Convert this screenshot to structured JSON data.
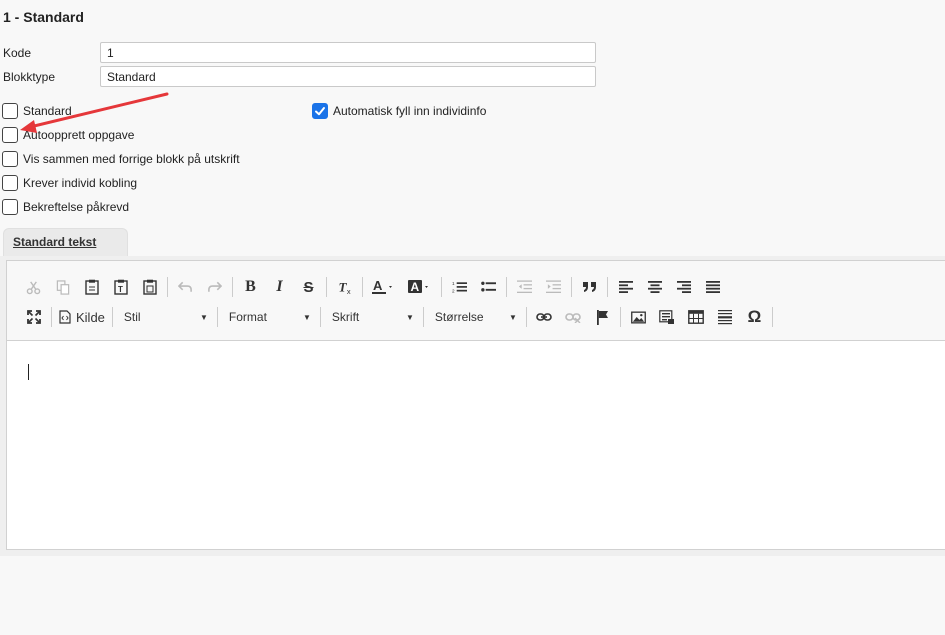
{
  "header": {
    "title": "1 - Standard"
  },
  "fields": {
    "kode": {
      "label": "Kode",
      "value": "1"
    },
    "blokktype": {
      "label": "Blokktype",
      "value": "Standard"
    }
  },
  "checkboxes": [
    {
      "label": "Standard",
      "checked": false
    },
    {
      "label": "Autoopprett oppgave",
      "checked": false
    },
    {
      "label": "Vis sammen med forrige blokk på utskrift",
      "checked": false
    },
    {
      "label": "Krever individ kobling",
      "checked": false
    },
    {
      "label": "Bekreftelse påkrevd",
      "checked": false
    }
  ],
  "auto_fill": {
    "label": "Automatisk fyll inn individinfo",
    "checked": true
  },
  "tab": {
    "label": "Standard tekst"
  },
  "toolbar": {
    "source_label": "Kilde",
    "style_label": "Stil",
    "format_label": "Format",
    "font_label": "Skrift",
    "size_label": "Størrelse",
    "bold": "B",
    "italic": "I",
    "strike": "S",
    "special_char": "Ω"
  },
  "colors": {
    "accent": "#1a73e8",
    "arrow": "#e5373a"
  }
}
